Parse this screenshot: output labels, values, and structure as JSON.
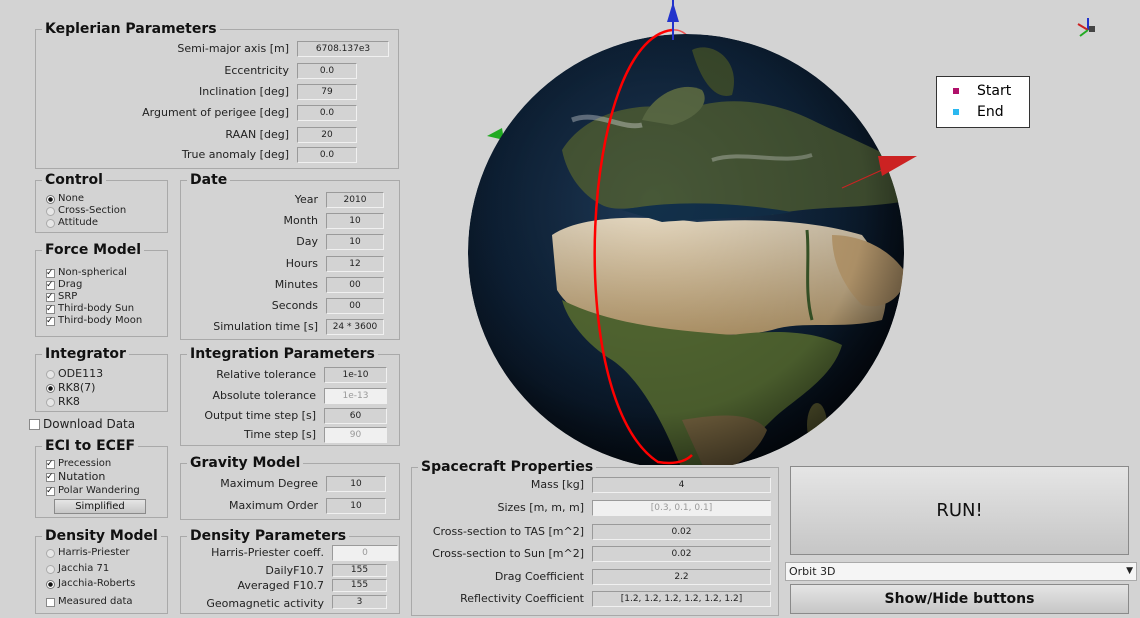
{
  "keplerian": {
    "title": "Keplerian Parameters",
    "rows": [
      {
        "label": "Semi-major axis [m]",
        "value": "6708.137e3"
      },
      {
        "label": "Eccentricity",
        "value": "0.0"
      },
      {
        "label": "Inclination [deg]",
        "value": "79"
      },
      {
        "label": "Argument of perigee [deg]",
        "value": "0.0"
      },
      {
        "label": "RAAN [deg]",
        "value": "20"
      },
      {
        "label": "True anomaly [deg]",
        "value": "0.0"
      }
    ]
  },
  "control": {
    "title": "Control",
    "options": [
      "None",
      "Cross-Section",
      "Attitude"
    ],
    "selected": "None"
  },
  "date": {
    "title": "Date",
    "rows": [
      {
        "label": "Year",
        "value": "2010"
      },
      {
        "label": "Month",
        "value": "10"
      },
      {
        "label": "Day",
        "value": "10"
      },
      {
        "label": "Hours",
        "value": "12"
      },
      {
        "label": "Minutes",
        "value": "00"
      },
      {
        "label": "Seconds",
        "value": "00"
      },
      {
        "label": "Simulation time [s]",
        "value": "24 * 3600"
      }
    ]
  },
  "force_model": {
    "title": "Force Model",
    "options": [
      "Non-spherical",
      "Drag",
      "SRP",
      "Third-body Sun",
      "Third-body Moon"
    ]
  },
  "integrator": {
    "title": "Integrator",
    "options": [
      "ODE113",
      "RK8(7)",
      "RK8"
    ],
    "selected": "RK8(7)"
  },
  "integration": {
    "title": "Integration Parameters",
    "rows": [
      {
        "label": "Relative tolerance",
        "value": "1e-10"
      },
      {
        "label": "Absolute tolerance",
        "value": "1e-13"
      },
      {
        "label": "Output time step [s]",
        "value": "60"
      },
      {
        "label": "Time step [s]",
        "value": "90"
      }
    ]
  },
  "download_data": "Download Data",
  "eci": {
    "title": "ECI to ECEF",
    "options": [
      "Precession",
      "Nutation",
      "Polar Wandering"
    ],
    "button": "Simplified"
  },
  "gravity": {
    "title": "Gravity Model",
    "rows": [
      {
        "label": "Maximum Degree",
        "value": "10"
      },
      {
        "label": "Maximum Order",
        "value": "10"
      }
    ]
  },
  "density_model": {
    "title": "Density Model",
    "options": [
      "Harris-Priester",
      "Jacchia 71",
      "Jacchia-Roberts"
    ],
    "selected": "Jacchia-Roberts",
    "measured": "Measured data"
  },
  "density_params": {
    "title": "Density Parameters",
    "rows": [
      {
        "label": "Harris-Priester coeff.",
        "value": "0"
      },
      {
        "label": "DailyF10.7",
        "value": "155"
      },
      {
        "label": "Averaged F10.7",
        "value": "155"
      },
      {
        "label": "Geomagnetic activity",
        "value": "3"
      }
    ]
  },
  "spacecraft": {
    "title": "Spacecraft Properties",
    "rows": [
      {
        "label": "Mass [kg]",
        "value": "4"
      },
      {
        "label": "Sizes [m, m, m]",
        "value": "[0.3, 0.1, 0.1]"
      },
      {
        "label": "Cross-section to TAS [m^2]",
        "value": "0.02"
      },
      {
        "label": "Cross-section to Sun [m^2]",
        "value": "0.02"
      },
      {
        "label": "Drag Coefficient",
        "value": "2.2"
      },
      {
        "label": "Reflectivity Coefficient",
        "value": "[1.2, 1.2, 1.2, 1.2, 1.2, 1.2]"
      }
    ]
  },
  "run_button": "RUN!",
  "view_select": "Orbit 3D",
  "show_hide_button": "Show/Hide buttons",
  "legend": {
    "start": "Start",
    "end": "End"
  },
  "colors": {
    "start": "#b0106a",
    "end": "#2ab8f0",
    "orbit": "#ff0000",
    "panel_bg": "#d3d3d3"
  }
}
